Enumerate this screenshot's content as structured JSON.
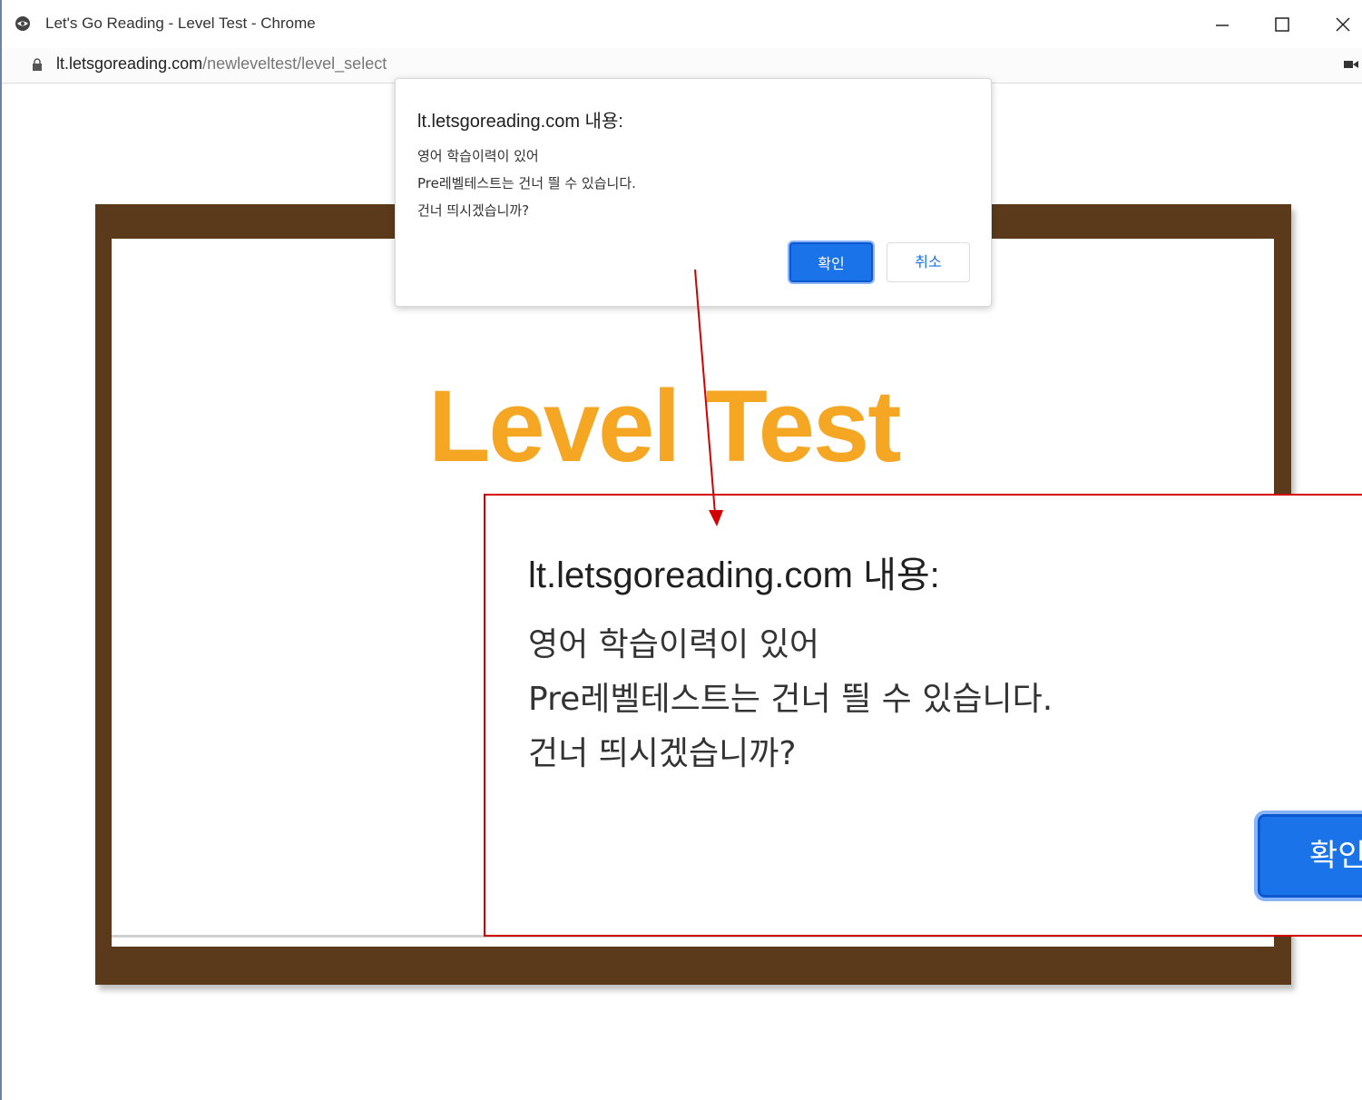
{
  "browser": {
    "window_title": "Let's Go Reading - Level Test - Chrome",
    "url_host": "lt.letsgoreading.com",
    "url_path": "/newleveltest/level_select"
  },
  "page": {
    "heading": "Level Test",
    "accent_color": "#f5a623",
    "frame_color": "#5b3a1b"
  },
  "dialog": {
    "origin": "lt.letsgoreading.com 내용:",
    "message_lines": [
      "영어 학습이력이 있어",
      "Pre레벨테스트는 건너 띌 수 있습니다.",
      "건너 띄시겠습니까?"
    ],
    "ok_label": "확인",
    "cancel_label": "취소"
  },
  "zoom": {
    "origin": "lt.letsgoreading.com 내용:",
    "message_lines": [
      "영어 학습이력이 있어",
      "Pre레벨테스트는 건너 띌 수 있습니다.",
      "건너 띄시겠습니까?"
    ],
    "ok_label": "확인",
    "annotation_color": "#d40000"
  }
}
